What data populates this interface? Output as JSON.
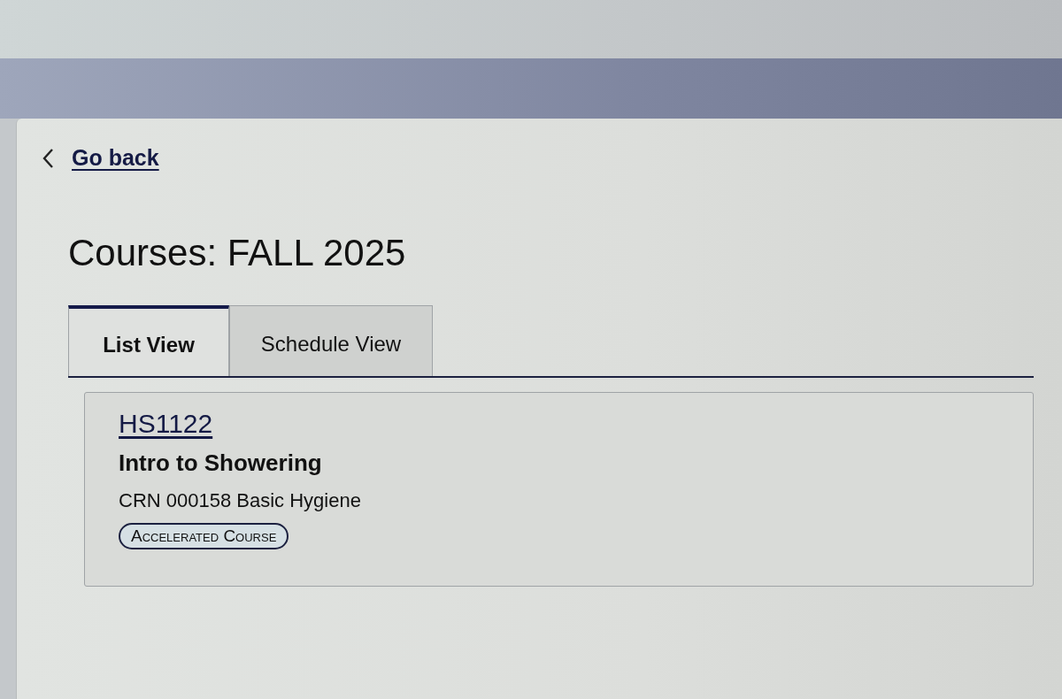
{
  "back_link": {
    "label": "Go back"
  },
  "title": "Courses: FALL 2025",
  "tabs": [
    {
      "label": "List View",
      "selected": true
    },
    {
      "label": "Schedule View",
      "selected": false
    }
  ],
  "courses": [
    {
      "code": "HS1122",
      "name": "Intro to Showering",
      "details": "CRN 000158 Basic Hygiene",
      "badges": [
        "Accelerated Course"
      ]
    }
  ]
}
